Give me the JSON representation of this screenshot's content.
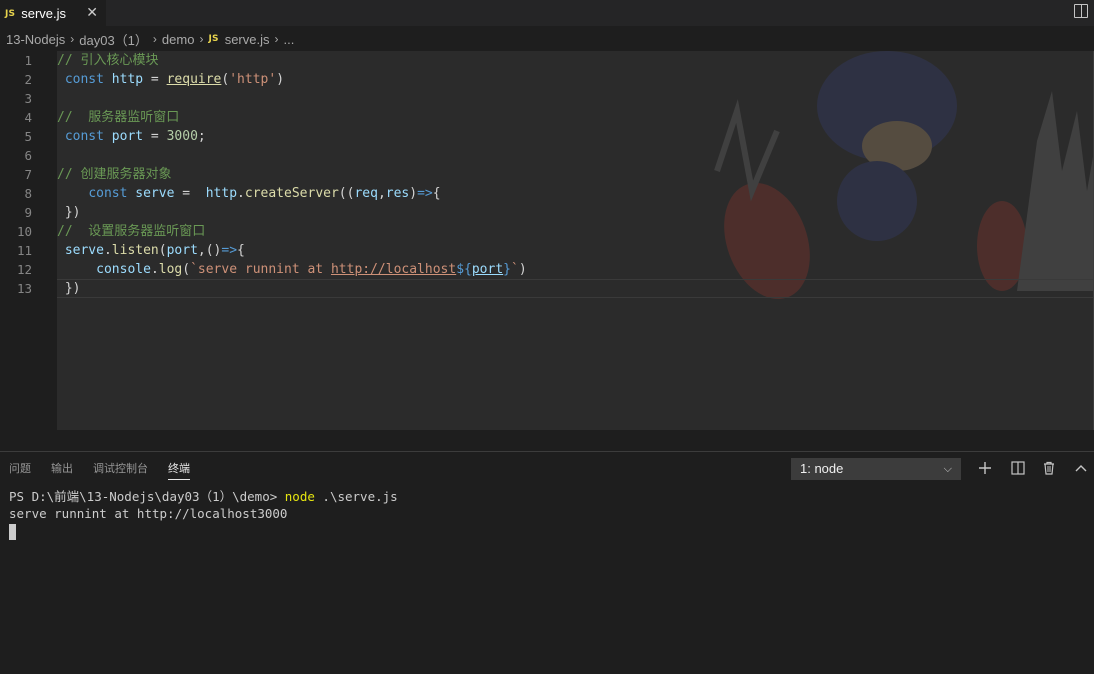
{
  "tab": {
    "badge": "JS",
    "filename": "serve.js",
    "close": "✕"
  },
  "breadcrumb": {
    "items": [
      "13-Nodejs",
      "day03（1）",
      "demo",
      "serve.js",
      "..."
    ],
    "file_badge": "JS",
    "sep": "›"
  },
  "editor": {
    "line_numbers": [
      "1",
      "2",
      "3",
      "4",
      "5",
      "6",
      "7",
      "8",
      "9",
      "10",
      "11",
      "12",
      "13"
    ],
    "lines": [
      "// 引入核心模块",
      " const http = require('http')",
      "",
      "//  服务器监听窗口",
      " const port = 3000;",
      "",
      "// 创建服务器对象",
      "    const serve =  http.createServer((req,res)=>{",
      " })",
      "//  设置服务器监听窗口",
      " serve.listen(port,()=>{",
      "     console.log(`serve runnint at http://localhost${port}`)",
      " })"
    ]
  },
  "panel": {
    "tabs": [
      "问题",
      "输出",
      "调试控制台",
      "终端"
    ],
    "active_tab": "终端",
    "terminal_select": "1: node",
    "terminal_lines": {
      "prompt": "PS D:\\前端\\13-Nodejs\\day03（1）\\demo> ",
      "cmd": "node",
      "args": " .\\serve.js",
      "output": "serve runnint at http://localhost3000"
    }
  },
  "icons": {
    "add": "plus-icon",
    "split": "split-terminal-icon",
    "trash": "trash-icon",
    "up": "chevron-up-icon"
  },
  "colors": {
    "keyword": "#569cd6",
    "comment": "#6a9955",
    "string": "#ce9178",
    "number": "#b5cea8",
    "function": "#dcdcaa",
    "variable": "#9cdcfe"
  }
}
